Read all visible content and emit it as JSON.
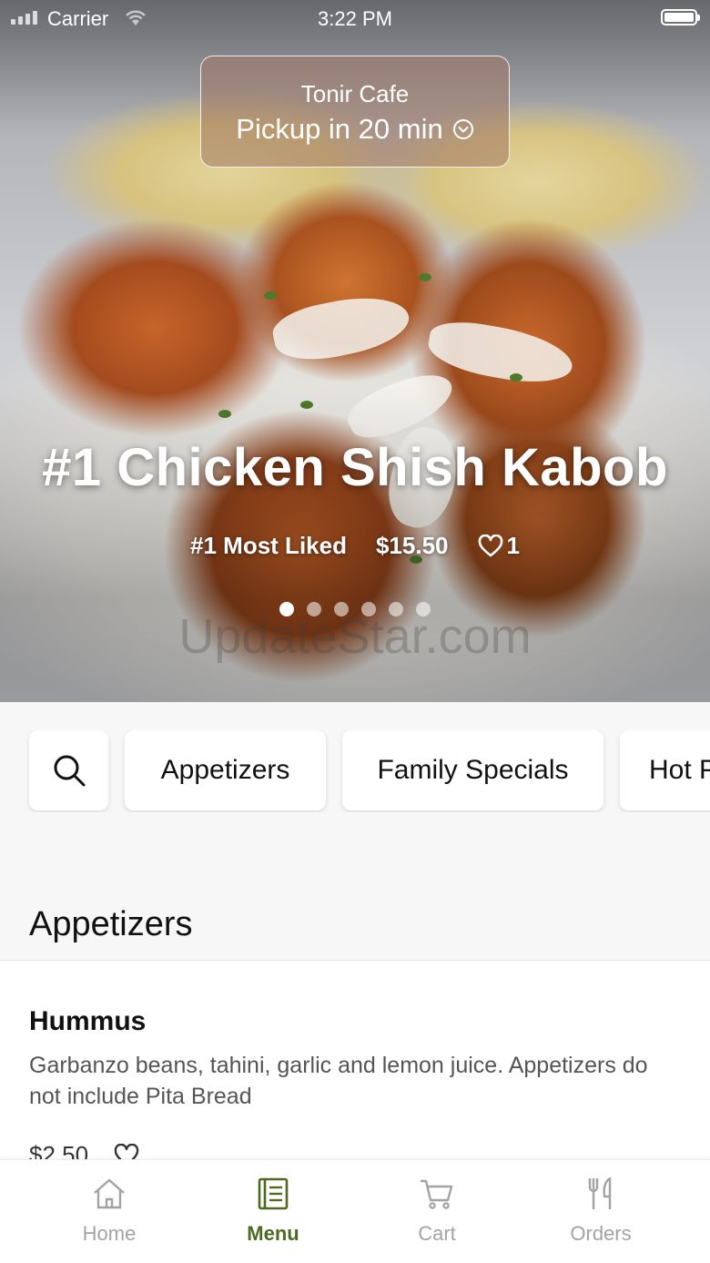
{
  "status_bar": {
    "carrier": "Carrier",
    "time": "3:22 PM"
  },
  "restaurant": {
    "name": "Tonir Cafe",
    "pickup_text": "Pickup in 20 min"
  },
  "featured": {
    "title": "#1 Chicken Shish Kabob",
    "badge": "#1 Most Liked",
    "price": "$15.50",
    "likes": "1",
    "carousel_dots": 6,
    "active_dot": 1
  },
  "watermark": "UpdateStar.com",
  "categories": [
    {
      "label": "Appetizers"
    },
    {
      "label": "Family Specials"
    },
    {
      "label": "Hot Plates"
    }
  ],
  "section": {
    "title": "Appetizers"
  },
  "menu_items": [
    {
      "name": "Hummus",
      "description": "Garbanzo beans, tahini, garlic and lemon juice. Appetizers do not include Pita Bread",
      "price": "$2.50"
    }
  ],
  "nav": [
    {
      "label": "Home",
      "icon": "home-icon"
    },
    {
      "label": "Menu",
      "icon": "menu-book-icon"
    },
    {
      "label": "Cart",
      "icon": "cart-icon"
    },
    {
      "label": "Orders",
      "icon": "fork-knife-icon"
    }
  ],
  "colors": {
    "accent": "#4e6a1f",
    "inactive": "#a3a3a3",
    "background": "#f7f7f7"
  }
}
